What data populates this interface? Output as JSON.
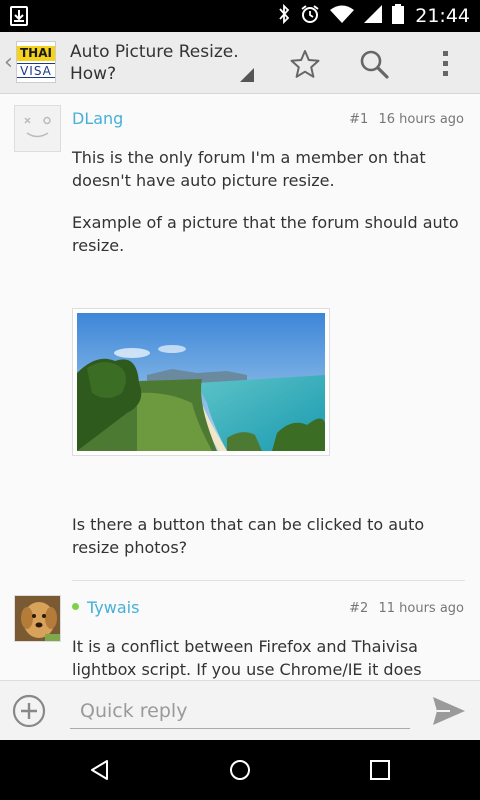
{
  "status_bar": {
    "time": "21:44",
    "icons": [
      "download-icon",
      "bluetooth-icon",
      "alarm-icon",
      "wifi-icon",
      "signal-icon",
      "battery-icon"
    ]
  },
  "action_bar": {
    "logo_top": "THAI",
    "logo_bottom": "VISA",
    "title": "Auto Picture Resize. How?",
    "icons": [
      "star-icon",
      "search-icon",
      "overflow-menu-icon"
    ]
  },
  "posts": [
    {
      "author": "DLang",
      "number": "#1",
      "time": "16 hours ago",
      "paragraphs": [
        "This is the only forum I'm a member on that doesn't have auto picture resize.",
        "Example of a picture that the forum should auto resize.",
        "Is there a button that can be clicked to auto resize photos?"
      ]
    },
    {
      "author": "Tywais",
      "online": true,
      "number": "#2",
      "time": "11 hours ago",
      "paragraphs": [
        "It is a conflict between Firefox and Thaivisa lightbox script.  If you use Chrome/IE it does"
      ]
    }
  ],
  "reply": {
    "placeholder": "Quick reply"
  },
  "colors": {
    "accent": "#46b0d8",
    "online": "#7bd148"
  }
}
